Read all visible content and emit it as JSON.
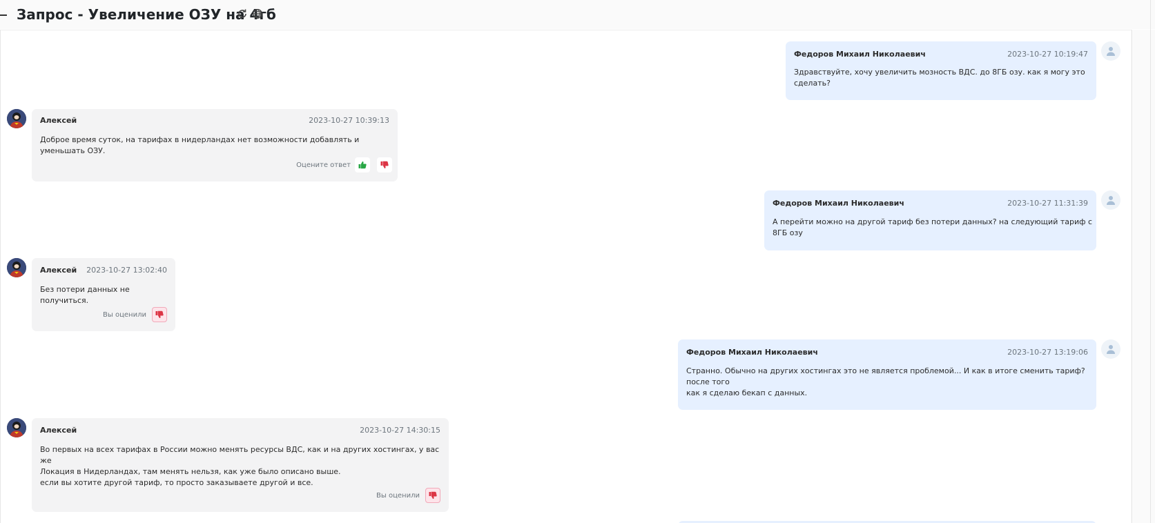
{
  "header": {
    "title": "Запрос - Увеличение ОЗУ на 4гб",
    "icons": [
      "refresh-icon",
      "globe-icon"
    ]
  },
  "messages": [
    {
      "role": "client",
      "author": "Федоров Михаил Николаевич",
      "time": "2023-10-27 10:19:47",
      "lines": [
        "Здравствуйте, хочу увеличить мозность ВДС. до 8ГБ озу. как я могу это сделать?"
      ]
    },
    {
      "role": "staff",
      "author": "Алексей",
      "time": "2023-10-27 10:39:13",
      "lines": [
        "Доброе время суток, на тарифах в нидерландах нет возможности добавлять и уменьшать ОЗУ."
      ],
      "rating": {
        "label": "Оцените ответ",
        "state": "unrated",
        "like_color": "#28a745",
        "dislike_color": "#dc3545"
      }
    },
    {
      "role": "client",
      "author": "Федоров Михаил Николаевич",
      "time": "2023-10-27 11:31:39",
      "lines": [
        "А перейти можно на другой тариф без потери данных? на следующий тариф с 8ГБ озу"
      ]
    },
    {
      "role": "staff",
      "author": "Алексей",
      "time": "2023-10-27 13:02:40",
      "lines": [
        "Без потери данных не получиться."
      ],
      "rating": {
        "label": "Вы оценили",
        "state": "disliked",
        "dislike_color": "#dc3545"
      }
    },
    {
      "role": "client",
      "author": "Федоров Михаил Николаевич",
      "time": "2023-10-27 13:19:06",
      "lines": [
        "Странно. Обычно на других хостингах это не является проблемой... И как в итоге сменить тариф? после того",
        "как я сделаю бекап с данных."
      ]
    },
    {
      "role": "staff",
      "author": "Алексей",
      "time": "2023-10-27 14:30:15",
      "lines": [
        "Во первых на всех тарифах в России можно менять ресурсы ВДС, как и на других хостингах, у вас же",
        "Локация в Нидерландах, там менять нельзя, как уже было описано выше.",
        "если вы хотите другой тариф, то просто заказываете другой и все."
      ],
      "rating": {
        "label": "Вы оценили",
        "state": "disliked",
        "dislike_color": "#dc3545"
      }
    }
  ],
  "colors": {
    "client_bubble": "#e6f0ff",
    "staff_bubble": "#f3f3f4",
    "accent_like": "#28a745",
    "accent_dislike": "#dc3545"
  }
}
